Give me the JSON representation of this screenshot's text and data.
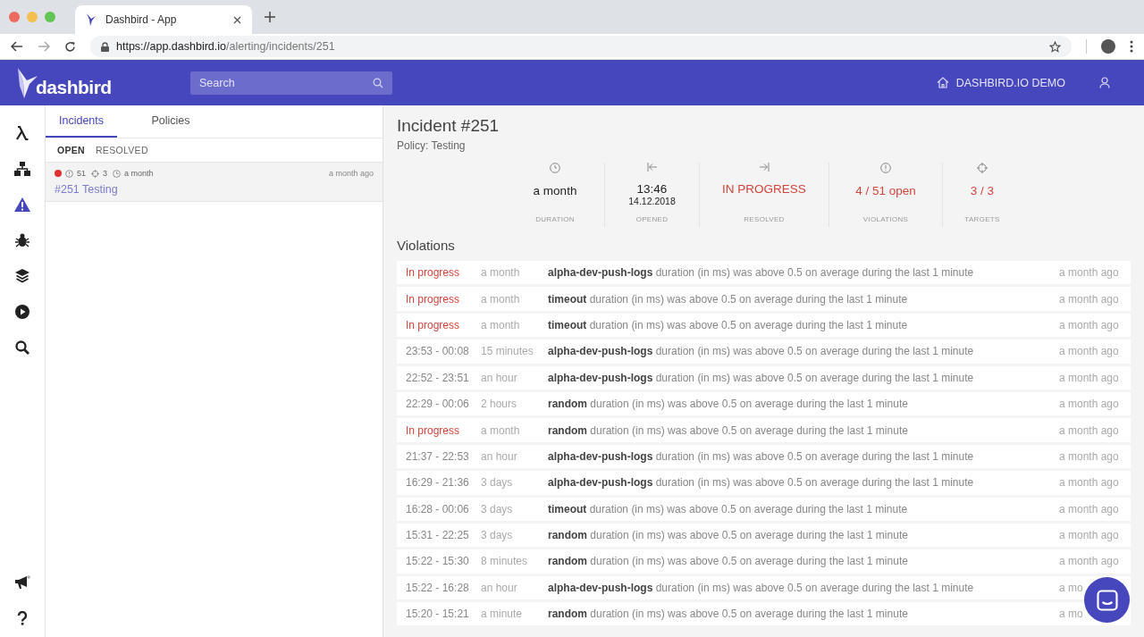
{
  "browser": {
    "tab_title": "Dashbird - App",
    "url_host": "https://app.dashbird.io",
    "url_path": "/alerting/incidents/251"
  },
  "header": {
    "logo": "dashbird",
    "search": {
      "placeholder": "Search"
    },
    "account": "DASHBIRD.IO DEMO"
  },
  "nav": [
    {
      "selected": false
    },
    {
      "selected": false
    },
    {
      "selected": true
    },
    {
      "selected": false
    },
    {
      "selected": false
    },
    {
      "selected": false
    },
    {
      "selected": false
    }
  ],
  "tabs": [
    {
      "label": "Incidents",
      "selected": true
    },
    {
      "label": "Policies",
      "selected": false
    }
  ],
  "filters": [
    {
      "label": "OPEN",
      "selected": true
    },
    {
      "label": "RESOLVED",
      "selected": false
    }
  ],
  "incidents": [
    {
      "color": "#e03131",
      "violations": "51",
      "targets": "3",
      "duration": "a month",
      "ago": "a month ago",
      "title": "#251 Testing",
      "selected": true
    }
  ],
  "incident": {
    "title": "Incident #251",
    "policy": "Policy: Testing",
    "stats": [
      {
        "value": "a month",
        "label": "DURATION",
        "alert": false
      },
      {
        "value": "13:46",
        "subvalue": "14.12.2018",
        "label": "OPENED",
        "alert": false
      },
      {
        "value": "IN PROGRESS",
        "label": "RESOLVED",
        "alert": true
      },
      {
        "value": "4 / 51 open",
        "label": "VIOLATIONS",
        "alert": true
      },
      {
        "value": "3 / 3",
        "label": "TARGETS",
        "alert": true
      }
    ]
  },
  "violations_title": "Violations",
  "violations": [
    {
      "kind": "in_progress",
      "period": "In progress",
      "duration": "a month",
      "target": "alpha-dev-push-logs",
      "message": "duration (in ms) was above 0.5 on average during the last 1 minute",
      "ago": "a month ago"
    },
    {
      "kind": "in_progress",
      "period": "In progress",
      "duration": "a month",
      "target": "timeout",
      "message": "duration (in ms) was above 0.5 on average during the last 1 minute",
      "ago": "a month ago"
    },
    {
      "kind": "in_progress",
      "period": "In progress",
      "duration": "a month",
      "target": "timeout",
      "message": "duration (in ms) was above 0.5 on average during the last 1 minute",
      "ago": "a month ago"
    },
    {
      "kind": "closed",
      "period": "23:53 - 00:08",
      "duration": "15 minutes",
      "target": "alpha-dev-push-logs",
      "message": "duration (in ms) was above 0.5 on average during the last 1 minute",
      "ago": "a month ago"
    },
    {
      "kind": "closed",
      "period": "22:52 - 23:51",
      "duration": "an hour",
      "target": "alpha-dev-push-logs",
      "message": "duration (in ms) was above 0.5 on average during the last 1 minute",
      "ago": "a month ago"
    },
    {
      "kind": "closed",
      "period": "22:29 - 00:06",
      "duration": "2 hours",
      "target": "random",
      "message": "duration (in ms) was above 0.5 on average during the last 1 minute",
      "ago": "a month ago"
    },
    {
      "kind": "in_progress",
      "period": "In progress",
      "duration": "a month",
      "target": "random",
      "message": "duration (in ms) was above 0.5 on average during the last 1 minute",
      "ago": "a month ago"
    },
    {
      "kind": "closed",
      "period": "21:37 - 22:53",
      "duration": "an hour",
      "target": "alpha-dev-push-logs",
      "message": "duration (in ms) was above 0.5 on average during the last 1 minute",
      "ago": "a month ago"
    },
    {
      "kind": "closed",
      "period": "16:29 - 21:36",
      "duration": "3 days",
      "target": "alpha-dev-push-logs",
      "message": "duration (in ms) was above 0.5 on average during the last 1 minute",
      "ago": "a month ago"
    },
    {
      "kind": "closed",
      "period": "16:28 - 00:06",
      "duration": "3 days",
      "target": "timeout",
      "message": "duration (in ms) was above 0.5 on average during the last 1 minute",
      "ago": "a month ago"
    },
    {
      "kind": "closed",
      "period": "15:31 - 22:25",
      "duration": "3 days",
      "target": "random",
      "message": "duration (in ms) was above 0.5 on average during the last 1 minute",
      "ago": "a month ago"
    },
    {
      "kind": "closed",
      "period": "15:22 - 15:30",
      "duration": "8 minutes",
      "target": "random",
      "message": "duration (in ms) was above 0.5 on average during the last 1 minute",
      "ago": "a month ago"
    },
    {
      "kind": "closed",
      "period": "15:22 - 16:28",
      "duration": "an hour",
      "target": "alpha-dev-push-logs",
      "message": "duration (in ms) was above 0.5 on average during the last 1 minute",
      "ago": "a mo"
    },
    {
      "kind": "closed",
      "period": "15:20 - 15:21",
      "duration": "a minute",
      "target": "random",
      "message": "duration (in ms) was above 0.5 on average during the last 1 minute",
      "ago": "a mo"
    }
  ]
}
